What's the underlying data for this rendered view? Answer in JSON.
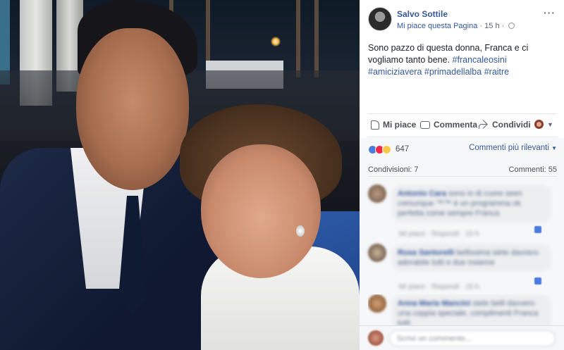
{
  "post": {
    "author": "Salvo Sottile",
    "page_like": "Mi piace questa Pagina",
    "separator": "·",
    "time": "15 h",
    "separator2": "·",
    "menu": "···",
    "text_plain": "Sono pazzo di questa donna, Franca e ci vogliamo tanto bene. ",
    "hashtags": [
      "#francaleosini",
      "#amiciziavera",
      "#primadellalba",
      "#raitre"
    ]
  },
  "actions": {
    "like": "Mi piace",
    "comment": "Commenta",
    "share": "Condividi",
    "reactions_caret": "▼"
  },
  "stats": {
    "reactions_count": "647",
    "sort_label": "Commenti più rilevanti",
    "sort_caret": "▼",
    "shares": "Condivisioni: 7",
    "comments": "Commenti: 55"
  },
  "comments": [
    {
      "name": "Antonio Cara",
      "text": "sono io di cuore seen comunque ™™ è un programma ok perfetta come sempre Franca",
      "meta": "Mi piace · Rispondi · 15 h"
    },
    {
      "name": "Rosa Santorelli",
      "text": "bellissima siete davvero adorabile tutti e due insieme",
      "meta": "Mi piace · Rispondi · 15 h"
    },
    {
      "name": "Anna Maria Mancini",
      "text": "siete belli davvero una coppia speciale, complimenti Franca tutti",
      "meta": "Mi piace · Rispondi"
    }
  ],
  "composer": {
    "placeholder": "Scrivi un commento..."
  }
}
